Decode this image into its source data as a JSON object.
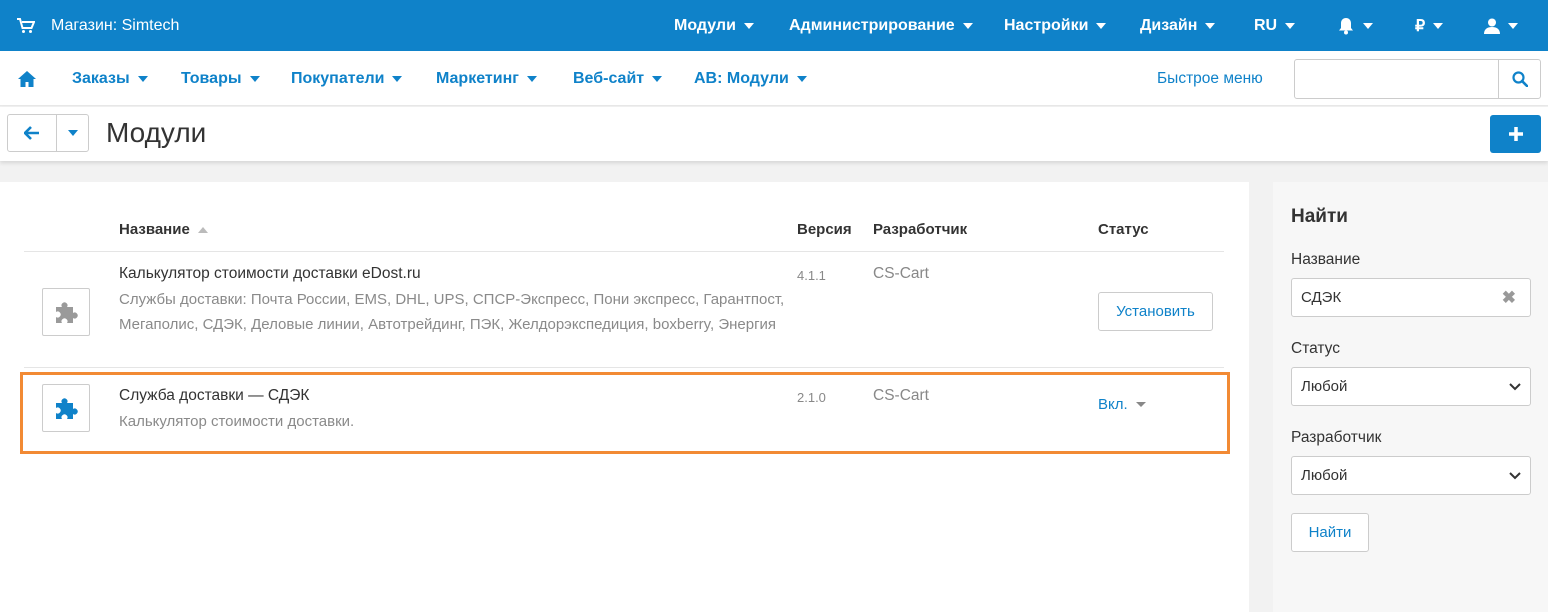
{
  "topbar": {
    "shop_label": "Магазин: Simtech",
    "menu": [
      "Модули",
      "Администрирование",
      "Настройки",
      "Дизайн",
      "RU"
    ],
    "currency": "₽"
  },
  "navbar": {
    "items": [
      "Заказы",
      "Товары",
      "Покупатели",
      "Маркетинг",
      "Веб-сайт",
      "AB: Модули"
    ],
    "quick_menu": "Быстрое меню",
    "search_placeholder": ""
  },
  "page": {
    "title": "Модули"
  },
  "table": {
    "headers": {
      "name": "Название",
      "version": "Версия",
      "developer": "Разработчик",
      "status": "Статус"
    },
    "rows": [
      {
        "name": "Калькулятор стоимости доставки eDost.ru",
        "description": "Службы доставки: Почта России, EMS, DHL, UPS, СПСР-Экспресс, Пони экспресс, Гарантпост, Мегаполис, СДЭК, Деловые линии, Автотрейдинг, ПЭК, Желдорэкспедиция, boxberry, Энергия",
        "version": "4.1.1",
        "developer": "CS-Cart",
        "action": "Установить",
        "icon": "puzzle-icon-gray"
      },
      {
        "name": "Служба доставки — СДЭК",
        "description": "Калькулятор стоимости доставки.",
        "version": "2.1.0",
        "developer": "CS-Cart",
        "status": "Вкл.",
        "icon": "puzzle-icon-blue"
      }
    ]
  },
  "sidebar": {
    "title": "Найти",
    "name_label": "Название",
    "name_value": "СДЭК",
    "status_label": "Статус",
    "status_value": "Любой",
    "developer_label": "Разработчик",
    "developer_value": "Любой",
    "find_button": "Найти"
  },
  "colors": {
    "brand": "#0f82c9",
    "highlight": "#f28a34"
  }
}
